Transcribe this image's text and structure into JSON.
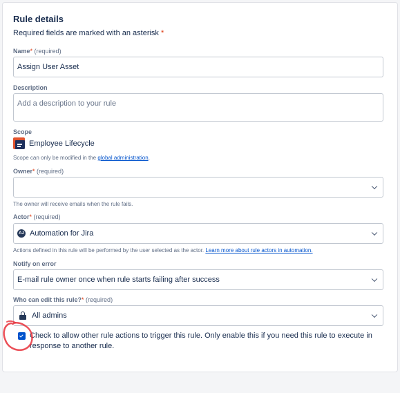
{
  "section": {
    "title": "Rule details",
    "required_note": "Required fields are marked with an asterisk",
    "required_star": "*"
  },
  "name_field": {
    "label": "Name",
    "star": "*",
    "required_text": "(required)",
    "value": "Assign User Asset"
  },
  "description_field": {
    "label": "Description",
    "placeholder": "Add a description to your rule"
  },
  "scope": {
    "label": "Scope",
    "name": "Employee Lifecycle",
    "helper_prefix": "Scope can only be modified in the ",
    "helper_link": "global administration",
    "helper_suffix": "."
  },
  "owner_field": {
    "label": "Owner",
    "star": "*",
    "required_text": "(required)",
    "value": "",
    "helper": "The owner will receive emails when the rule fails."
  },
  "actor_field": {
    "label": "Actor",
    "star": "*",
    "required_text": "(required)",
    "avatar_text": "AJ",
    "value": "Automation for Jira",
    "helper_prefix": "Actions defined in this rule will be performed by the user selected as the actor. ",
    "helper_link": "Learn more about rule actors in automation."
  },
  "notify_field": {
    "label": "Notify on error",
    "value": "E-mail rule owner once when rule starts failing after success"
  },
  "edit_field": {
    "label": "Who can edit this rule?",
    "star": "*",
    "required_text": "(required)",
    "value": "All admins"
  },
  "trigger_checkbox": {
    "checked": true,
    "label": "Check to allow other rule actions to trigger this rule. Only enable this if you need this rule to execute in response to another rule."
  },
  "colors": {
    "accent": "#0052cc",
    "required": "#de350b",
    "annotation": "#e8303a"
  }
}
